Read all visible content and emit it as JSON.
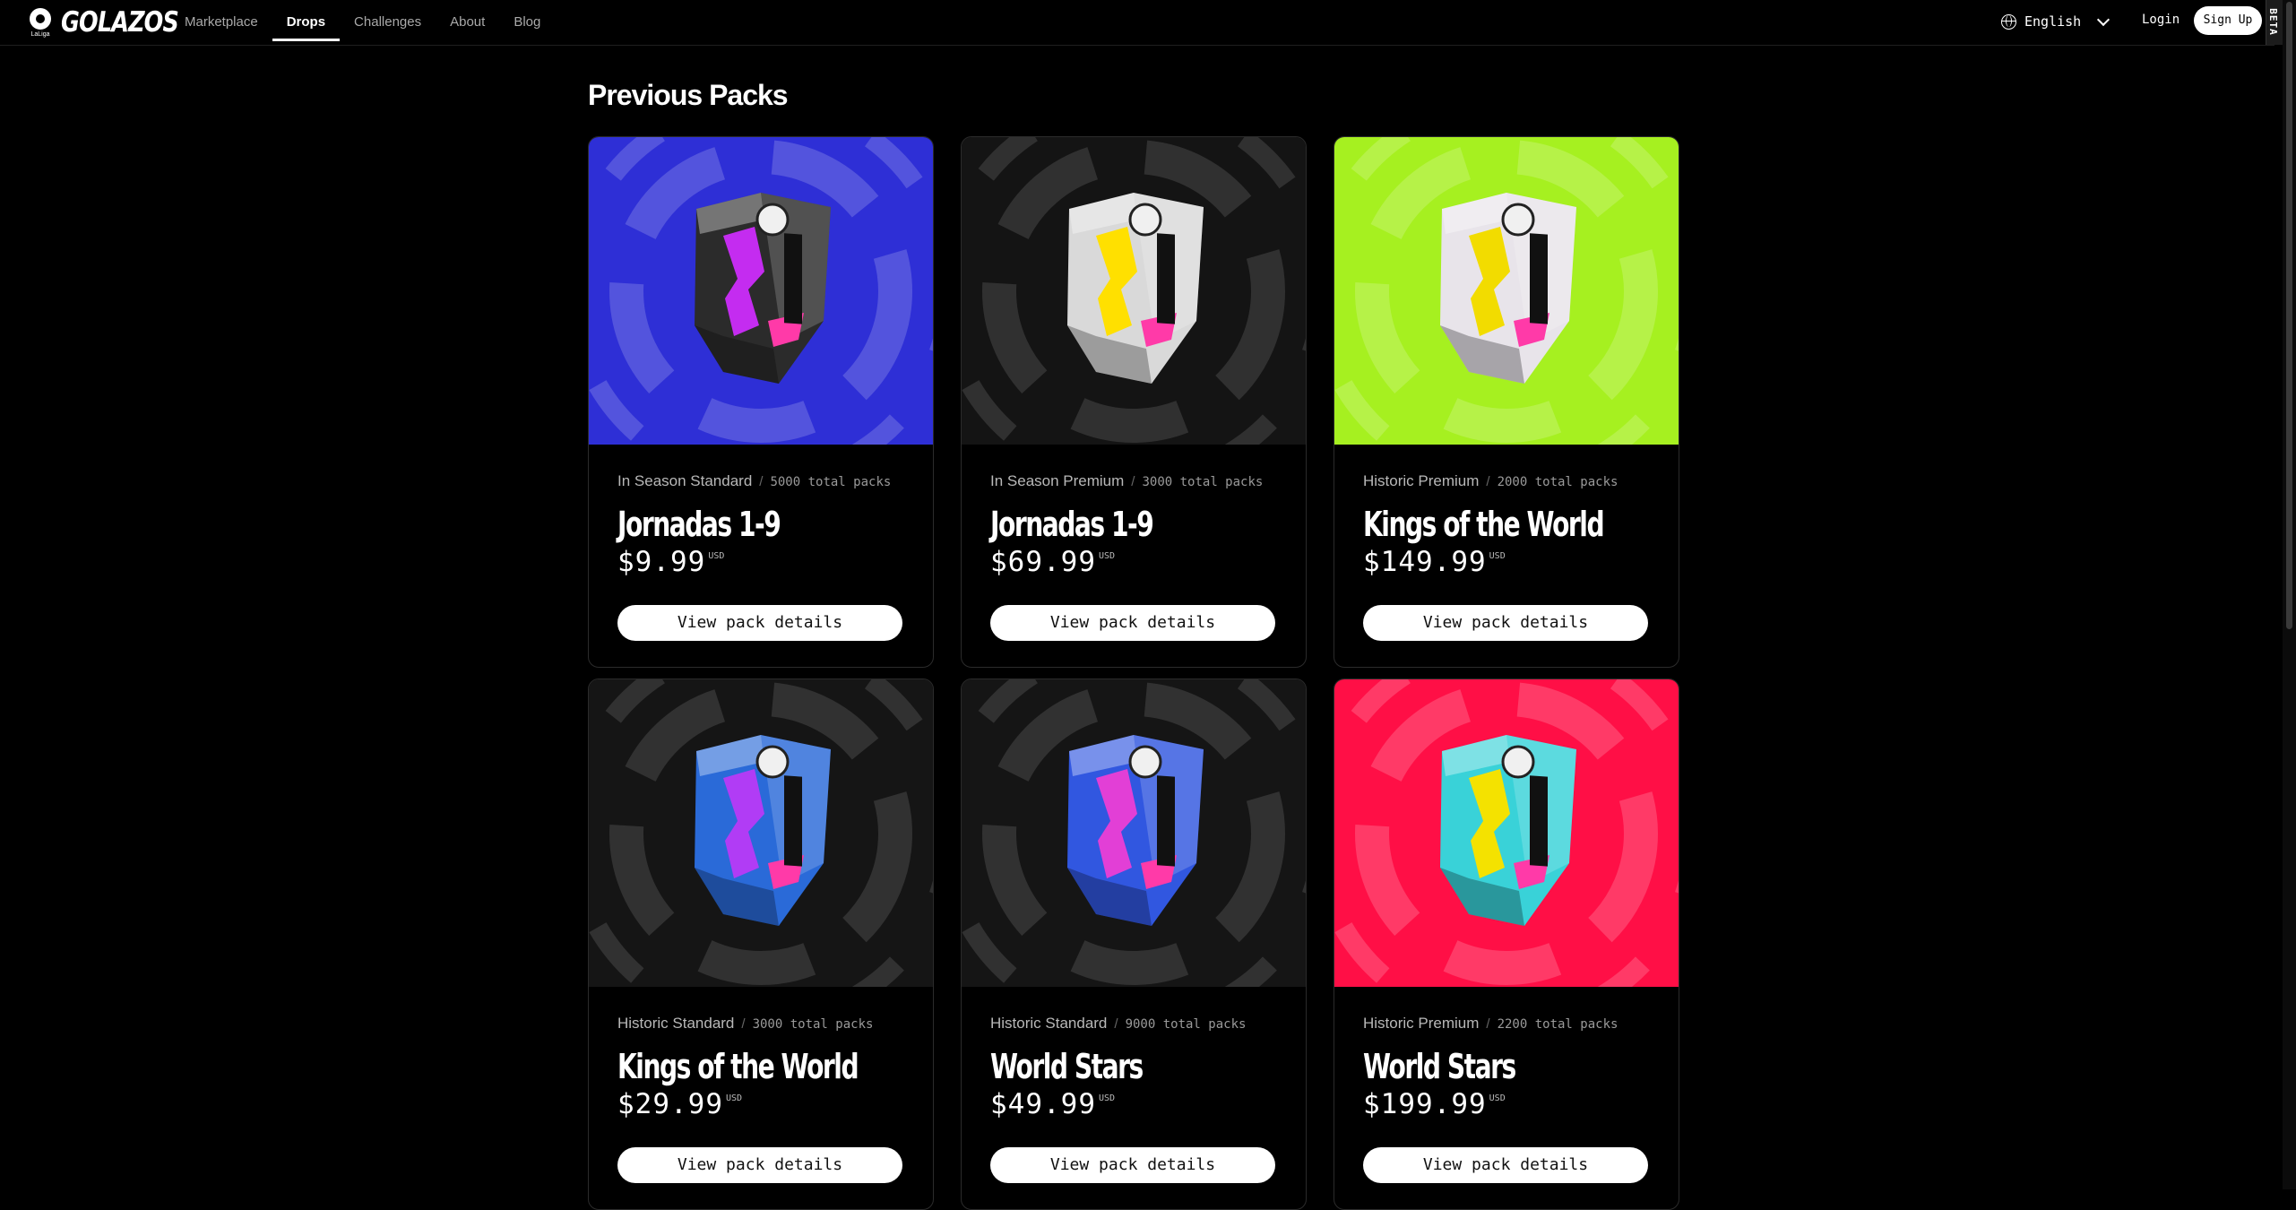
{
  "brand": {
    "name": "GOLAZOS",
    "league": "LaLiga"
  },
  "nav": {
    "items": [
      {
        "label": "Marketplace",
        "active": false
      },
      {
        "label": "Drops",
        "active": true
      },
      {
        "label": "Challenges",
        "active": false
      },
      {
        "label": "About",
        "active": false
      },
      {
        "label": "Blog",
        "active": false
      }
    ]
  },
  "header": {
    "language": "English",
    "login": "Login",
    "signup": "Sign Up",
    "beta": "BETA"
  },
  "section": {
    "title": "Previous Packs"
  },
  "packs": [
    {
      "category": "In Season Standard",
      "separator": "/",
      "total": "5000 total packs",
      "title": "Jornadas 1-9",
      "price": "$9.99",
      "currency": "USD",
      "button": "View pack details",
      "background": "#2e2fd6",
      "box_color": "#2b2b2b",
      "accent": "#c42cf0"
    },
    {
      "category": "In Season Premium",
      "separator": "/",
      "total": "3000 total packs",
      "title": "Jornadas 1-9",
      "price": "$69.99",
      "currency": "USD",
      "button": "View pack details",
      "background": "#141414",
      "box_color": "#d9d9d9",
      "accent": "#ffe000"
    },
    {
      "category": "Historic Premium",
      "separator": "/",
      "total": "2000 total packs",
      "title": "Kings of the World",
      "price": "$149.99",
      "currency": "USD",
      "button": "View pack details",
      "background": "#a6f020",
      "box_color": "#e8e4ea",
      "accent": "#f2dc00"
    },
    {
      "category": "Historic Standard",
      "separator": "/",
      "total": "3000 total packs",
      "title": "Kings of the World",
      "price": "$29.99",
      "currency": "USD",
      "button": "View pack details",
      "background": "#151515",
      "box_color": "#2a6ad8",
      "accent": "#b13cf5"
    },
    {
      "category": "Historic Standard",
      "separator": "/",
      "total": "9000 total packs",
      "title": "World Stars",
      "price": "$49.99",
      "currency": "USD",
      "button": "View pack details",
      "background": "#151515",
      "box_color": "#3157e0",
      "accent": "#e23fd6"
    },
    {
      "category": "Historic Premium",
      "separator": "/",
      "total": "2200 total packs",
      "title": "World Stars",
      "price": "$199.99",
      "currency": "USD",
      "button": "View pack details",
      "background": "#ff0f46",
      "box_color": "#39d2d8",
      "accent": "#f4e200"
    }
  ]
}
